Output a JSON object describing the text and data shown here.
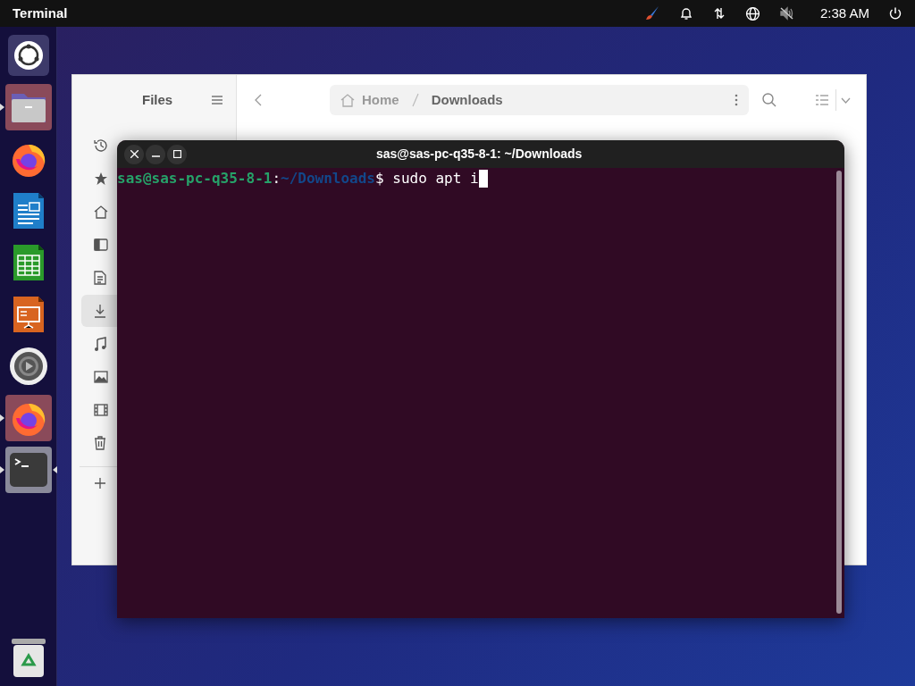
{
  "top_bar": {
    "app_name": "Terminal",
    "clock": "2:38 AM"
  },
  "dock": {
    "items": [
      {
        "kind": "ubuntu",
        "running": false,
        "focused": false
      },
      {
        "kind": "files",
        "running": true,
        "focused": false
      },
      {
        "kind": "firefox",
        "running": false,
        "focused": false
      },
      {
        "kind": "writer",
        "running": false,
        "focused": false
      },
      {
        "kind": "calc",
        "running": false,
        "focused": false
      },
      {
        "kind": "impress",
        "running": false,
        "focused": false
      },
      {
        "kind": "settings",
        "running": false,
        "focused": false
      },
      {
        "kind": "firefox",
        "running": true,
        "focused": false
      },
      {
        "kind": "terminal",
        "running": true,
        "focused": true
      }
    ],
    "trash": {
      "kind": "trash"
    }
  },
  "files_window": {
    "title": "Files",
    "sidebar": {
      "items": [
        {
          "kind": "recent",
          "selected": false
        },
        {
          "kind": "starred",
          "selected": false
        },
        {
          "kind": "home",
          "selected": false
        },
        {
          "kind": "desktop",
          "selected": false
        },
        {
          "kind": "documents",
          "selected": false
        },
        {
          "kind": "downloads",
          "selected": true
        },
        {
          "kind": "music",
          "selected": false
        },
        {
          "kind": "pictures",
          "selected": false
        },
        {
          "kind": "videos",
          "selected": false
        },
        {
          "kind": "trash",
          "selected": false
        }
      ]
    },
    "path": [
      "Home",
      "Downloads"
    ]
  },
  "terminal_window": {
    "title": "sas@sas-pc-q35-8-1: ~/Downloads",
    "prompt": {
      "user_host": "sas@sas-pc-q35-8-1",
      "separator": ":",
      "cwd": "~/Downloads",
      "symbol": "$",
      "command": "sudo apt i"
    }
  }
}
